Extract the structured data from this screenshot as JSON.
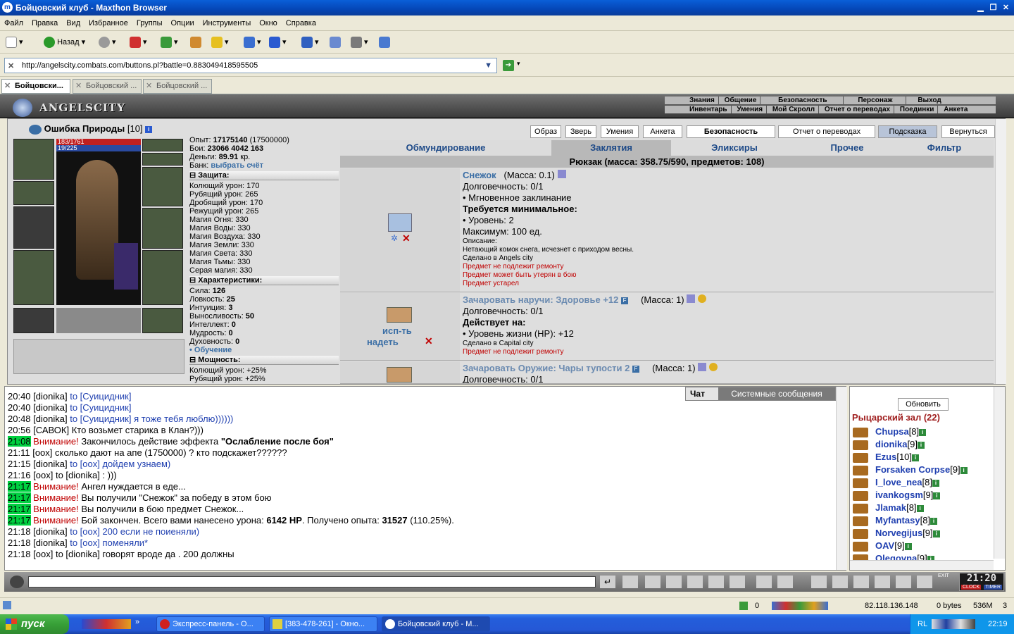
{
  "window": {
    "title": "Бойцовский клуб - Maxthon Browser"
  },
  "menu": [
    "Файл",
    "Правка",
    "Вид",
    "Избранное",
    "Группы",
    "Опции",
    "Инструменты",
    "Окно",
    "Справка"
  ],
  "toolbar": {
    "back_label": "Назад"
  },
  "address": {
    "url": "http://angelscity.combats.com/buttons.pl?battle=0.883049418595505"
  },
  "browser_tabs": [
    "Бойцовски...",
    "Бойцовский ...",
    "Бойцовский ..."
  ],
  "game_header": {
    "logo": "ANGELSCITY",
    "top_menu": [
      "Знания",
      "Общение",
      "Безопасность",
      "Персонаж",
      "Выход"
    ],
    "sub_menu": [
      "Инвентарь",
      "Умения",
      "Мой Скролл",
      "Отчет о переводах",
      "Поединки",
      "Анкета"
    ]
  },
  "character": {
    "name": "Ошибка Природы",
    "level": "[10]",
    "hp": "183/1761",
    "mana": "19/225",
    "exp_label": "Опыт:",
    "exp_value": "17175140",
    "exp_next": "(17500000)",
    "fights_label": "Бои:",
    "wins": "23066",
    "losses": "4042",
    "draws": "163",
    "money_label": "Деньги:",
    "money_value": "89.91",
    "money_unit": "кр.",
    "bank_label": "Банк:",
    "bank_link": "выбрать счёт"
  },
  "protection": {
    "title": "Защита:",
    "rows": [
      "Колющий урон: 170",
      "Рубящий урон: 265",
      "Дробящий урон: 170",
      "Режущий урон: 265",
      "Магия Огня: 330",
      "Магия Воды: 330",
      "Магия Воздуха: 330",
      "Магия Земли: 330",
      "Магия Света: 330",
      "Магия Тьмы: 330",
      "Серая магия: 330"
    ]
  },
  "characteristics": {
    "title": "Характеристики:",
    "rows": [
      {
        "label": "Сила:",
        "value": "126"
      },
      {
        "label": "Ловкость:",
        "value": "25"
      },
      {
        "label": "Интуиция:",
        "value": "3"
      },
      {
        "label": "Выносливость:",
        "value": "50"
      },
      {
        "label": "Интеллект:",
        "value": "0"
      },
      {
        "label": "Мудрость:",
        "value": "0"
      },
      {
        "label": "Духовность:",
        "value": "0"
      }
    ],
    "training_link": "• Обучение"
  },
  "power": {
    "title": "Мощность:",
    "rows": [
      "Колющий урон: +25%",
      "Рубящий урон: +25%"
    ]
  },
  "action_buttons": [
    "Образ",
    "Зверь",
    "Умения",
    "Анкета",
    "Безопасность",
    "Отчет о переводах",
    "Подсказка",
    "Вернуться"
  ],
  "category_tabs": [
    "Обмундирование",
    "Заклятия",
    "Эликсиры",
    "Прочее",
    "Фильтр"
  ],
  "active_category": "Заклятия",
  "backpack_line": "Рюкзак (масса: 358.75/590, предметов: 108)",
  "items": [
    {
      "name": "Снежок",
      "mass": "(Масса: 0.1)",
      "durability": "Долговечность: 0/1",
      "instant": "• Мгновенное заклинание",
      "req_title": "Требуется минимальное:",
      "req_level": "• Уровень: 2",
      "max": "Максимум: 100 ед.",
      "desc_label": "Описание:",
      "desc": "Нетающий комок снега, исчезнет с приходом весны.",
      "made": "Сделано в Angels city",
      "notes": [
        "Предмет не подлежит ремонту",
        "Предмет может быть утерян в бою",
        "Предмет устарел"
      ]
    },
    {
      "name": "Зачаровать наручи: Здоровье +12",
      "mass": "(Масса: 1)",
      "durability": "Долговечность: 0/1",
      "acts_title": "Действует на:",
      "effect": "• Уровень жизни (HP): +12",
      "made": "Сделано в Capital city",
      "notes": [
        "Предмет не подлежит ремонту"
      ],
      "use_label": "исп-ть",
      "wear_label": "надеть"
    },
    {
      "name": "Зачаровать Оружие: Чары тупости 2",
      "mass": "(Масса: 1)",
      "durability": "Долговечность: 0/1"
    }
  ],
  "chat": {
    "tabs": [
      "Чат",
      "Системные сообщения"
    ],
    "lines": [
      {
        "time": "20:40",
        "parts": [
          {
            "t": "[dionika]",
            "c": "nick"
          },
          {
            "t": " to [Суицидник]",
            "c": "blue"
          }
        ]
      },
      {
        "time": "20:40",
        "parts": [
          {
            "t": "[dionika]",
            "c": "nick"
          },
          {
            "t": " to [Суицидник]",
            "c": "blue"
          }
        ]
      },
      {
        "time": "20:48",
        "parts": [
          {
            "t": "[dionika]",
            "c": "nick"
          },
          {
            "t": " to [Суицидник] я тоже тебя люблю))))))",
            "c": "blue"
          }
        ]
      },
      {
        "time": "20:56",
        "parts": [
          {
            "t": "[САВОК]",
            "c": "nick"
          },
          {
            "t": " Кто возьмет старика в Клан?)))",
            "c": "nick"
          }
        ]
      },
      {
        "time": "21:08",
        "green": true,
        "parts": [
          {
            "t": "Внимание!",
            "c": "redt"
          },
          {
            "t": " Закончилось действие эффекта ",
            "c": "nick"
          },
          {
            "t": "\"Ослабление после боя\"",
            "c": "bold"
          }
        ]
      },
      {
        "time": "21:11",
        "parts": [
          {
            "t": "[oox]",
            "c": "nick"
          },
          {
            "t": " сколько дают на апе (1750000) ? кто подскажет??????",
            "c": "nick"
          }
        ]
      },
      {
        "time": "21:15",
        "parts": [
          {
            "t": "[dionika]",
            "c": "nick"
          },
          {
            "t": " to [oox] дойдем узнаем)",
            "c": "blue"
          }
        ]
      },
      {
        "time": "21:16",
        "parts": [
          {
            "t": "[oox]",
            "c": "nick"
          },
          {
            "t": " to [dionika] : )))",
            "c": "nick"
          }
        ]
      },
      {
        "time": "21:17",
        "green": true,
        "parts": [
          {
            "t": "Внимание!",
            "c": "redt"
          },
          {
            "t": " Ангел нуждается в еде...",
            "c": "nick"
          }
        ]
      },
      {
        "time": "21:17",
        "green": true,
        "parts": [
          {
            "t": "Внимание!",
            "c": "redt"
          },
          {
            "t": " Вы получили \"Снежок\" за победу в этом бою",
            "c": "nick"
          }
        ]
      },
      {
        "time": "21:17",
        "green": true,
        "parts": [
          {
            "t": "Внимание!",
            "c": "redt"
          },
          {
            "t": " Вы получили в бою предмет Снежок...",
            "c": "nick"
          }
        ]
      },
      {
        "time": "21:17",
        "green": true,
        "parts": [
          {
            "t": "Внимание!",
            "c": "redt"
          },
          {
            "t": " Бой закончен. Всего вами нанесено урона: ",
            "c": "nick"
          },
          {
            "t": "6142 HP",
            "c": "bold"
          },
          {
            "t": ". Получено опыта: ",
            "c": "nick"
          },
          {
            "t": "31527",
            "c": "bold"
          },
          {
            "t": " (110.25%).",
            "c": "nick"
          }
        ]
      },
      {
        "time": "21:18",
        "parts": [
          {
            "t": "[dionika]",
            "c": "nick"
          },
          {
            "t": " to [oox] 200 если не поиеняли)",
            "c": "blue"
          }
        ]
      },
      {
        "time": "21:18",
        "parts": [
          {
            "t": "[dionika]",
            "c": "nick"
          },
          {
            "t": " to [oox] поменяли*",
            "c": "blue"
          }
        ]
      },
      {
        "time": "21:18",
        "parts": [
          {
            "t": "[oox]",
            "c": "nick"
          },
          {
            "t": " to [dionika] говорят вроде да . 200 должны",
            "c": "nick"
          }
        ]
      }
    ]
  },
  "online": {
    "refresh_label": "Обновить",
    "room": "Рыцарский зал (22)",
    "users": [
      {
        "name": "Chupsa",
        "lvl": "[8]"
      },
      {
        "name": "dionika",
        "lvl": "[9]"
      },
      {
        "name": "Ezus",
        "lvl": "[10]"
      },
      {
        "name": "Forsaken Corpse",
        "lvl": "[9]"
      },
      {
        "name": "I_love_nea",
        "lvl": "[8]"
      },
      {
        "name": "ivankogsm",
        "lvl": "[9]"
      },
      {
        "name": "Jlamak",
        "lvl": "[8]"
      },
      {
        "name": "Myfantasy",
        "lvl": "[8]"
      },
      {
        "name": "Norvegijus",
        "lvl": "[9]"
      },
      {
        "name": "OAV",
        "lvl": "[9]"
      },
      {
        "name": "Olegovna",
        "lvl": "[9]"
      }
    ]
  },
  "clock": {
    "time": "21:20",
    "label1": "CLOCK",
    "label2": "TIMER",
    "exit": "EXIT"
  },
  "statusbar": {
    "count": "0",
    "ip": "82.118.136.148",
    "bytes": "0 bytes",
    "mem": "536M",
    "num": "3"
  },
  "taskbar": {
    "start": "пуск",
    "tasks": [
      "Экспресс-панель - О...",
      "[383-478-261] - Окно...",
      "Бойцовский клуб - М..."
    ],
    "lang": "RL",
    "time": "22:19"
  }
}
